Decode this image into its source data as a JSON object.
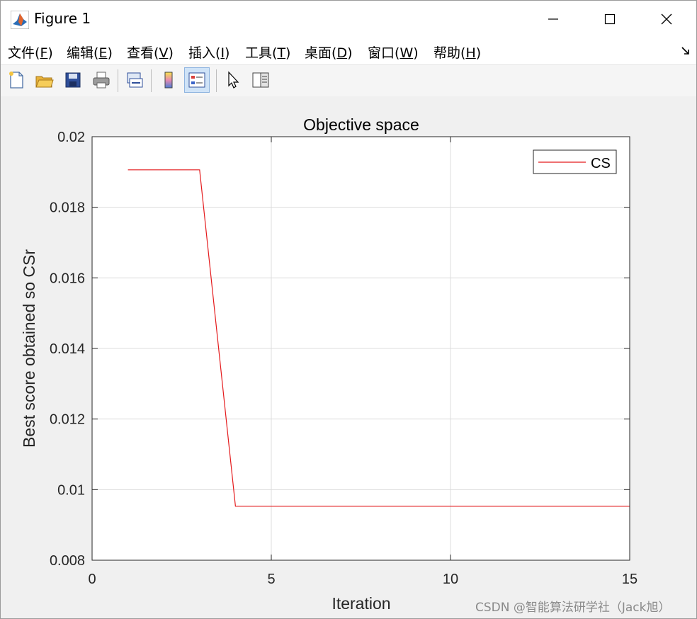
{
  "window": {
    "title": "Figure 1",
    "controls": {
      "minimize": "—",
      "maximize": "☐",
      "close": "✕"
    }
  },
  "menu": [
    {
      "label": "文件",
      "key": "F"
    },
    {
      "label": "编辑",
      "key": "E"
    },
    {
      "label": "查看",
      "key": "V"
    },
    {
      "label": "插入",
      "key": "I"
    },
    {
      "label": "工具",
      "key": "T"
    },
    {
      "label": "桌面",
      "key": "D"
    },
    {
      "label": "窗口",
      "key": "W"
    },
    {
      "label": "帮助",
      "key": "H"
    }
  ],
  "toolbar": [
    {
      "name": "new-figure-icon"
    },
    {
      "name": "open-file-icon"
    },
    {
      "name": "save-icon"
    },
    {
      "name": "print-icon"
    },
    {
      "name": "link-plot-icon"
    },
    {
      "name": "colorbar-icon"
    },
    {
      "name": "legend-icon",
      "active": true
    },
    {
      "name": "pointer-icon"
    },
    {
      "name": "property-editor-icon"
    }
  ],
  "colors": {
    "series": "#e41a1c",
    "grid": "#dcdcdc",
    "axes_bg": "#ffffff"
  },
  "chart_data": {
    "type": "line",
    "title": "Objective space",
    "xlabel": "Iteration",
    "ylabel": "Best score obtained so CSr",
    "xlim": [
      0,
      15
    ],
    "ylim": [
      0.008,
      0.02
    ],
    "xticks": [
      0,
      5,
      10,
      15
    ],
    "xtick_labels": [
      "0",
      "5",
      "10",
      "15"
    ],
    "yticks": [
      0.008,
      0.01,
      0.012,
      0.014,
      0.016,
      0.018,
      0.02
    ],
    "ytick_labels": [
      "0.008",
      "0.01",
      "0.012",
      "0.014",
      "0.016",
      "0.018",
      "0.02"
    ],
    "grid": true,
    "legend_position": "top-right",
    "series": [
      {
        "name": "CS",
        "x": [
          1,
          2,
          3,
          4,
          5,
          6,
          7,
          8,
          9,
          10,
          11,
          12,
          13,
          14,
          15
        ],
        "y": [
          0.01906,
          0.01906,
          0.01906,
          0.00953,
          0.00953,
          0.00953,
          0.00953,
          0.00953,
          0.00953,
          0.00953,
          0.00953,
          0.00953,
          0.00953,
          0.00953,
          0.00953
        ]
      }
    ]
  },
  "watermark": "CSDN @智能算法研学社（Jack旭）"
}
